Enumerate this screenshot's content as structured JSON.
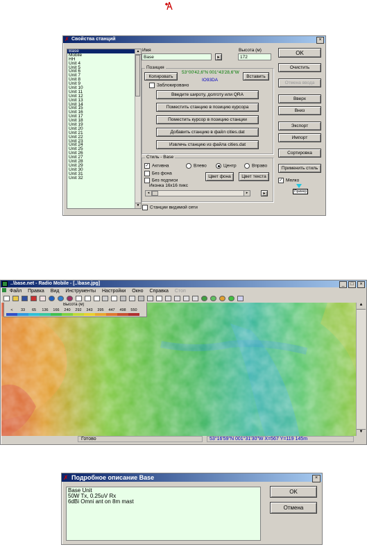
{
  "top_icon": {
    "name": "add-station-icon"
  },
  "station_dialog": {
    "title": "Свойства станций",
    "stations": [
      "Base",
      "Mobile",
      "HH",
      "Unit  4",
      "Unit  5",
      "Unit  6",
      "Unit  7",
      "Unit  8",
      "Unit  9",
      "Unit  10",
      "Unit  11",
      "Unit  12",
      "Unit  13",
      "Unit  14",
      "Unit  15",
      "Unit  16",
      "Unit  17",
      "Unit  18",
      "Unit  19",
      "Unit  20",
      "Unit  21",
      "Unit  22",
      "Unit  23",
      "Unit  24",
      "Unit  25",
      "Unit  26",
      "Unit  27",
      "Unit  28",
      "Unit  29",
      "Unit  30",
      "Unit  31",
      "Unit  32"
    ],
    "selected_index": 0,
    "name_label": "Имя",
    "name_value": "Base",
    "height_label": "Высота (м)",
    "height_value": "172",
    "position_caption": "Позиция",
    "copy_button": "Копировать",
    "coords": "53°00'42,6\"N 001°43'28,6\"W",
    "paste_button": "Вставить",
    "qra": "IO93DA",
    "locked_label": "Заблокировано",
    "buttons_mid": [
      "Введите широту, долготу или QRA",
      "Поместить станцию в позицию курсора",
      "Поместить курсор в позицию станции",
      "Добавить станцию в файл cities.dat",
      "Извлечь станцию из файла cities.dat"
    ],
    "style_caption": "Стиль - Base",
    "active_label": "Активна",
    "left_label": "Влево",
    "center_label": "Центр",
    "right_label": "Вправо",
    "no_bg_label": "Без фона",
    "no_caption_label": "Без подписи",
    "bg_color_button": "Цвет фона",
    "text_color_button": "Цвет текста",
    "icon_label": "Иконка 16x16 пикс",
    "visible_net_label": "Станции видимой сети",
    "right_buttons": [
      "OK",
      "Очистить",
      "Отмена ввода",
      "Вверх",
      "Вниз",
      "Экспорт",
      "Импорт",
      "Сортировка",
      "Применить стиль"
    ],
    "small_label": "Мелко",
    "sample_label": "Пример"
  },
  "radio_mobile": {
    "title": "..\\base.net - Radio Mobile - [..\\base.jpg]",
    "menu": [
      "Файл",
      "Правка",
      "Вид",
      "Инструменты",
      "Настройки",
      "Окно",
      "Справка",
      "Стоп"
    ],
    "legend_title": "Высота (м)",
    "legend_values": [
      "<",
      "33",
      "65",
      "136",
      "166",
      "240",
      "292",
      "343",
      "395",
      "447",
      "498",
      "550"
    ],
    "legend_colors": [
      "#3050c8",
      "#2f9ae0",
      "#2fc0d8",
      "#38c8a0",
      "#40c050",
      "#80d040",
      "#c0d838",
      "#e8d030",
      "#e8a830",
      "#e07830",
      "#c85030",
      "#b03030"
    ],
    "status_ready": "Готово",
    "status_coords": "53°16'59\"N 001°31'30\"W  X=567 Y=119 145m"
  },
  "detail_dialog": {
    "title": "Подробное описание Base",
    "lines": [
      "Base Unit",
      "50W Tx, 0.25uV Rx",
      "6dBi Omni ant on 8m mast"
    ],
    "ok_button": "OK",
    "cancel_button": "Отмена"
  }
}
